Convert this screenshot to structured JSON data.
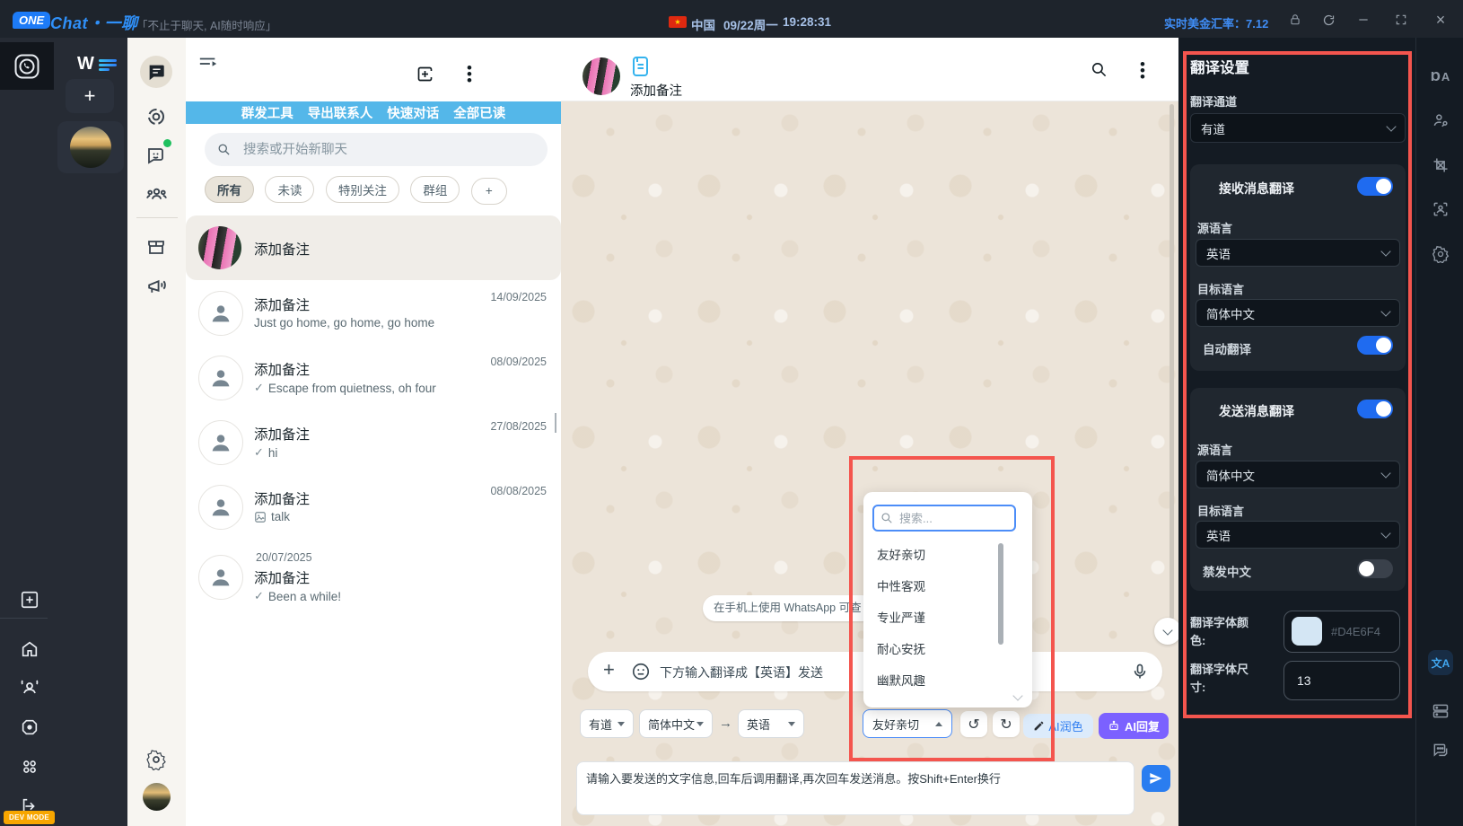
{
  "titlebar": {
    "logo_one": "ONE",
    "logo_chat": "Chat・一聊",
    "tagline": "「不止于聊天, AI随时响应」",
    "flag_star": "★",
    "region": "中国",
    "date": "09/22周一",
    "time": "19:28:31",
    "exchange_rate": "实时美金汇率：7.12"
  },
  "left_rail": {
    "add_label": "+",
    "dev_mode": "DEV MODE",
    "wl_logo": "W"
  },
  "chat_list": {
    "banner": [
      "群发工具",
      "导出联系人",
      "快速对话",
      "全部已读"
    ],
    "search_placeholder": "搜索或开始新聊天",
    "filters": [
      "所有",
      "未读",
      "特别关注",
      "群组",
      "+"
    ],
    "rows": [
      {
        "name": "添加备注",
        "preview": "",
        "date": "",
        "selected": true
      },
      {
        "name": "添加备注",
        "preview": "Just go home, go home, go home",
        "date": "14/09/2025"
      },
      {
        "name": "添加备注",
        "preview": "Escape from quietness, oh four",
        "date": "08/09/2025",
        "check": "✓"
      },
      {
        "name": "添加备注",
        "preview": "hi",
        "date": "27/08/2025",
        "check": "✓"
      },
      {
        "name": "添加备注",
        "preview": "talk",
        "date": "08/08/2025",
        "media": true
      },
      {
        "name": "添加备注",
        "preview": "Been a while!",
        "date": "20/07/2025",
        "check": "✓",
        "date_inline": true
      }
    ]
  },
  "chat": {
    "header_name": "添加备注",
    "tooltip": "在手机上使用 WhatsApp 可查",
    "input_placeholder": "下方输入翻译成【英语】发送",
    "compose_placeholder": "请输入要发送的文字信息,回车后调用翻译,再次回车发送消息。按Shift+Enter换行"
  },
  "toolbar": {
    "engine": "有道",
    "source_lang": "简体中文",
    "arrow": "→",
    "target_lang": "英语",
    "tone": "友好亲切",
    "undo": "↺",
    "redo": "↻",
    "polish": "AI润色",
    "reply": "AI回复"
  },
  "tone_dropdown": {
    "search_placeholder": "搜索...",
    "options": [
      "友好亲切",
      "中性客观",
      "专业严谨",
      "耐心安抚",
      "幽默风趣"
    ]
  },
  "settings": {
    "title": "翻译设置",
    "channel_label": "翻译通道",
    "channel_value": "有道",
    "receive": {
      "title": "接收消息翻译",
      "enabled": true,
      "source_label": "源语言",
      "source": "英语",
      "target_label": "目标语言",
      "target": "简体中文",
      "auto_label": "自动翻译",
      "auto_enabled": true
    },
    "send": {
      "title": "发送消息翻译",
      "enabled": true,
      "source_label": "源语言",
      "source": "简体中文",
      "target_label": "目标语言",
      "target": "英语",
      "ban_label": "禁发中文",
      "ban_enabled": false
    },
    "font_color_label": "翻译字体颜色:",
    "font_color_value": "#D4E6F4",
    "font_color_hex": "#D4E6F4",
    "font_size_label": "翻译字体尺寸:",
    "font_size_value": "13"
  },
  "colors": {
    "accent_blue": "#1f6bf0",
    "banner_blue": "#54b7e9",
    "highlight_red": "#f4554e",
    "reply_purple": "#7b61ff",
    "dev_orange": "#f7a600"
  }
}
